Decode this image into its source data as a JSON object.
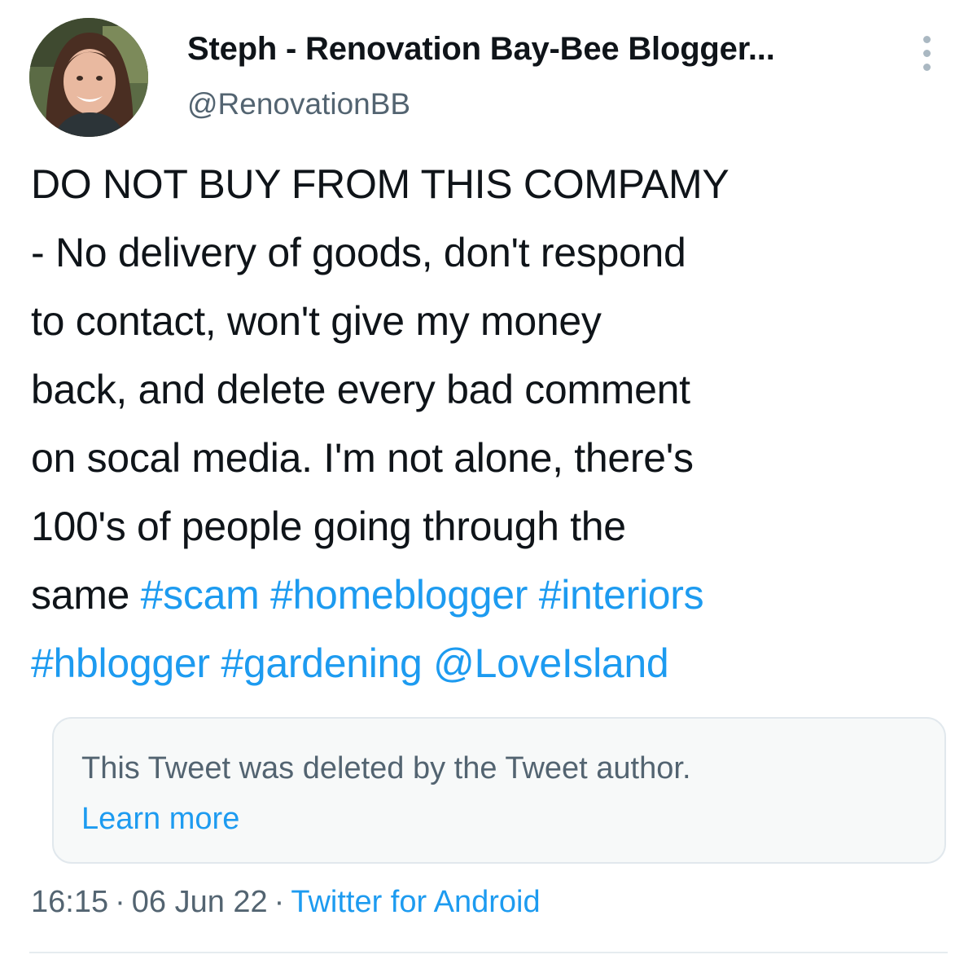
{
  "author": {
    "display_name": "Steph - Renovation Bay-Bee Blogger...",
    "handle": "@RenovationBB"
  },
  "menu_icon": "vertical-ellipsis-icon",
  "tweet": {
    "lines": [
      "DO NOT BUY FROM THIS COMPAMY",
      "- No delivery of goods, don't respond",
      "to contact, won't give my money",
      "back, and delete every bad comment",
      "on socal media. I'm not alone, there's",
      "100's of people going through the"
    ],
    "last_line_prefix": "same ",
    "hashtags_line1": [
      "#scam",
      "#homeblogger",
      "#interiors"
    ],
    "hashtags_line2": [
      "#hblogger",
      "#gardening"
    ],
    "mention": "@LoveIsland"
  },
  "quoted": {
    "message": "This Tweet was deleted by the Tweet author.",
    "link_label": "Learn more"
  },
  "meta": {
    "time": "16:15",
    "date": "06 Jun 22",
    "source": "Twitter for Android",
    "separator": "·"
  },
  "colors": {
    "link": "#1d9bf0",
    "text": "#0f1419",
    "muted": "#536471",
    "box_bg": "#f7f9f9",
    "box_border": "#e1e8ed"
  }
}
